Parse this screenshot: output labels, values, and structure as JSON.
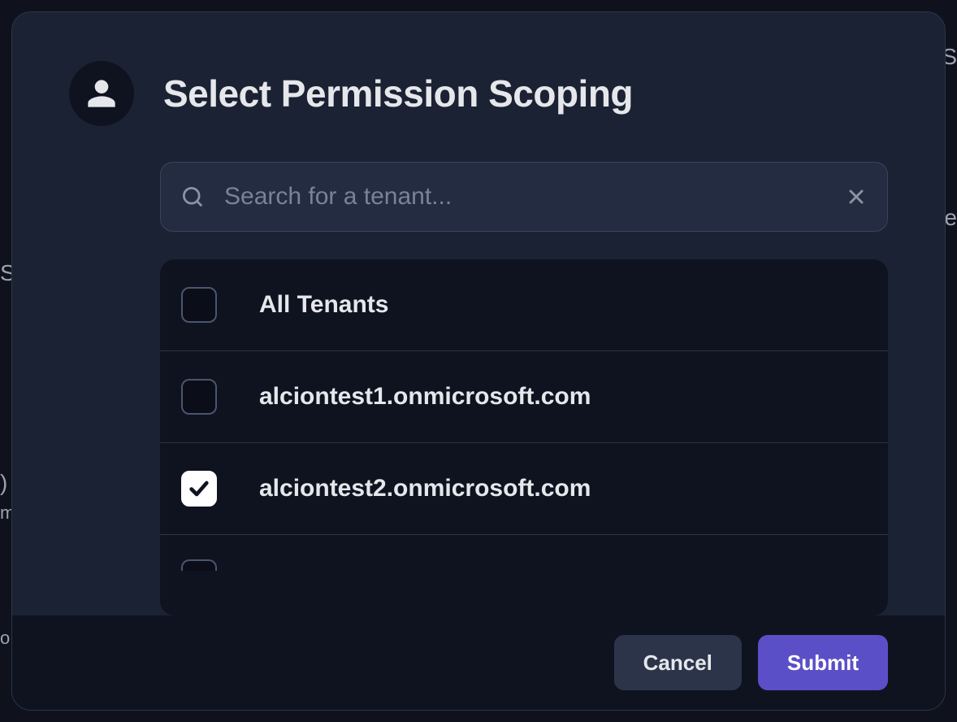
{
  "modal": {
    "title": "Select Permission Scoping"
  },
  "search": {
    "placeholder": "Search for a tenant...",
    "value": ""
  },
  "tenants": [
    {
      "label": "All Tenants",
      "checked": false
    },
    {
      "label": "alciontest1.onmicrosoft.com",
      "checked": false
    },
    {
      "label": "alciontest2.onmicrosoft.com",
      "checked": true
    }
  ],
  "footer": {
    "cancel_label": "Cancel",
    "submit_label": "Submit"
  },
  "colors": {
    "accent": "#5B4FC7",
    "modal_bg": "#1B2233",
    "panel_bg": "#0F1320"
  }
}
